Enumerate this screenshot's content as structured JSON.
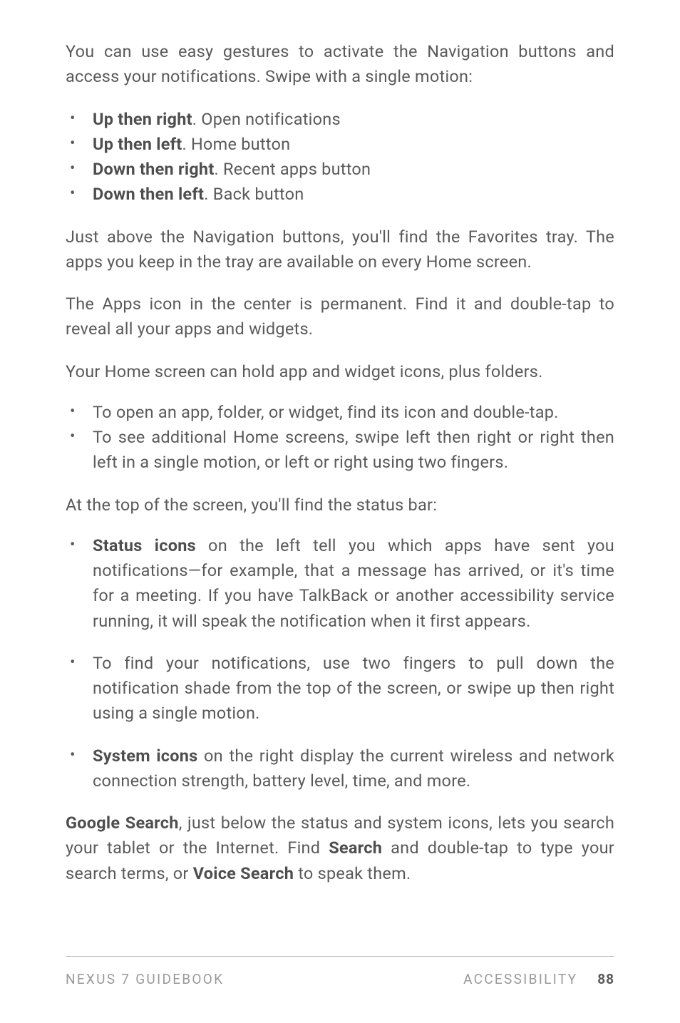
{
  "p1": "You can use easy gestures to activate the Navigation buttons and access your notifications. Swipe with a single motion:",
  "list1": [
    {
      "bold": "Up then right",
      "rest": ". Open notifications"
    },
    {
      "bold": "Up then left",
      "rest": ". Home button"
    },
    {
      "bold": "Down then right",
      "rest": ". Recent apps button"
    },
    {
      "bold": "Down then left",
      "rest": ". Back button"
    }
  ],
  "p2": "Just above the Navigation buttons, you'll find the Favorites tray. The apps you keep in the tray are available on every Home screen.",
  "p3": "The Apps icon in the center is permanent. Find it and double-tap to reveal all your apps and widgets.",
  "p4": "Your Home screen can hold app and widget icons, plus folders.",
  "list2": [
    "To open an app, folder, or widget, find its icon and double-tap.",
    "To see additional Home screens, swipe left then right or right then left in a single motion, or left or right using two fingers."
  ],
  "p5": "At the top of the screen, you'll find the status bar:",
  "list3a_bold": "Status icons",
  "list3a_rest": " on the left tell you which apps have sent you notifications—for example, that a message has arrived, or it's time for a meeting. If you have TalkBack or another accessibility service running, it will speak the notification when it first appears.",
  "list3b": "To find your notifications, use two fingers to pull down the notification shade from the top of the screen, or swipe up then right using a single motion.",
  "list3c_bold": "System icons",
  "list3c_rest": " on the right display the current wireless and network connection strength, battery level, time, and more.",
  "p6_bold1": "Google Search",
  "p6_mid1": ", just below the status and system icons, lets you search your tablet or the Internet. Find ",
  "p6_bold2": "Search",
  "p6_mid2": " and double-tap to type your search terms, or ",
  "p6_bold3": "Voice Search",
  "p6_end": " to speak them.",
  "footer": {
    "book": "NEXUS 7 GUIDEBOOK",
    "section": "ACCESSIBILITY",
    "page": "88"
  }
}
